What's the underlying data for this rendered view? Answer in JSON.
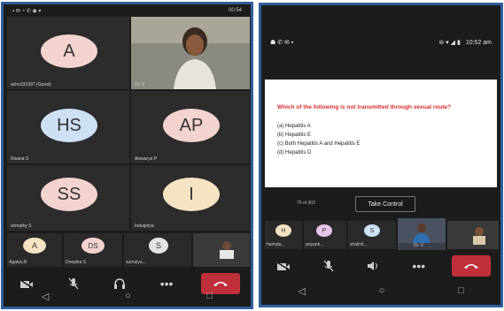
{
  "left": {
    "status_time": "00:54",
    "participants": [
      {
        "initials": "A",
        "name": "acho331997 (Guest)",
        "color": "#f3d3d0"
      },
      {
        "initials": "",
        "name": "Dr. V",
        "video": true
      },
      {
        "initials": "HS",
        "name": "Nisana S",
        "color": "#cde0f4"
      },
      {
        "initials": "AP",
        "name": "Aiswarya P",
        "color": "#f3d3d0"
      },
      {
        "initials": "SS",
        "name": "srimathy S",
        "color": "#f3d3d0"
      },
      {
        "initials": "I",
        "name": "Induipriya",
        "color": "#f5e3c3"
      }
    ],
    "strip": [
      {
        "initials": "A",
        "name": "Agatya.B",
        "color": "#f5e3c3"
      },
      {
        "initials": "DS",
        "name": "Deepika S",
        "color": "#f3d3d0"
      },
      {
        "initials": "S",
        "name": "sumalya...",
        "color": "#e3e3e3"
      },
      {
        "initials": "",
        "name": "",
        "photo": true
      }
    ]
  },
  "right": {
    "status_time": "10:52 am",
    "question": "Which of the following is not transmitted through sexual route?",
    "options": [
      "(a) Hepatitis A",
      "(b) Hepatitis E",
      "(c) Both Hepatitis A and Hepatitis E",
      "(d) Hepatitis D"
    ],
    "page_counter": "70 of 302",
    "take_control_label": "Take Control",
    "strip": [
      {
        "initials": "H",
        "name": "hemala...",
        "color": "#f5e3c3"
      },
      {
        "initials": "P",
        "name": "priyank...",
        "color": "#e6c6e6"
      },
      {
        "initials": "S",
        "name": "shalinit...",
        "color": "#cde0f4"
      },
      {
        "initials": "",
        "name": "Dr. V",
        "photo": true
      },
      {
        "initials": "",
        "name": "",
        "photo": true
      }
    ]
  },
  "icons": {
    "video_off": "video-off-icon",
    "mic_off": "mic-off-icon",
    "audio": "speaker-icon",
    "more": "more-icon",
    "end_call": "end-call-icon"
  }
}
